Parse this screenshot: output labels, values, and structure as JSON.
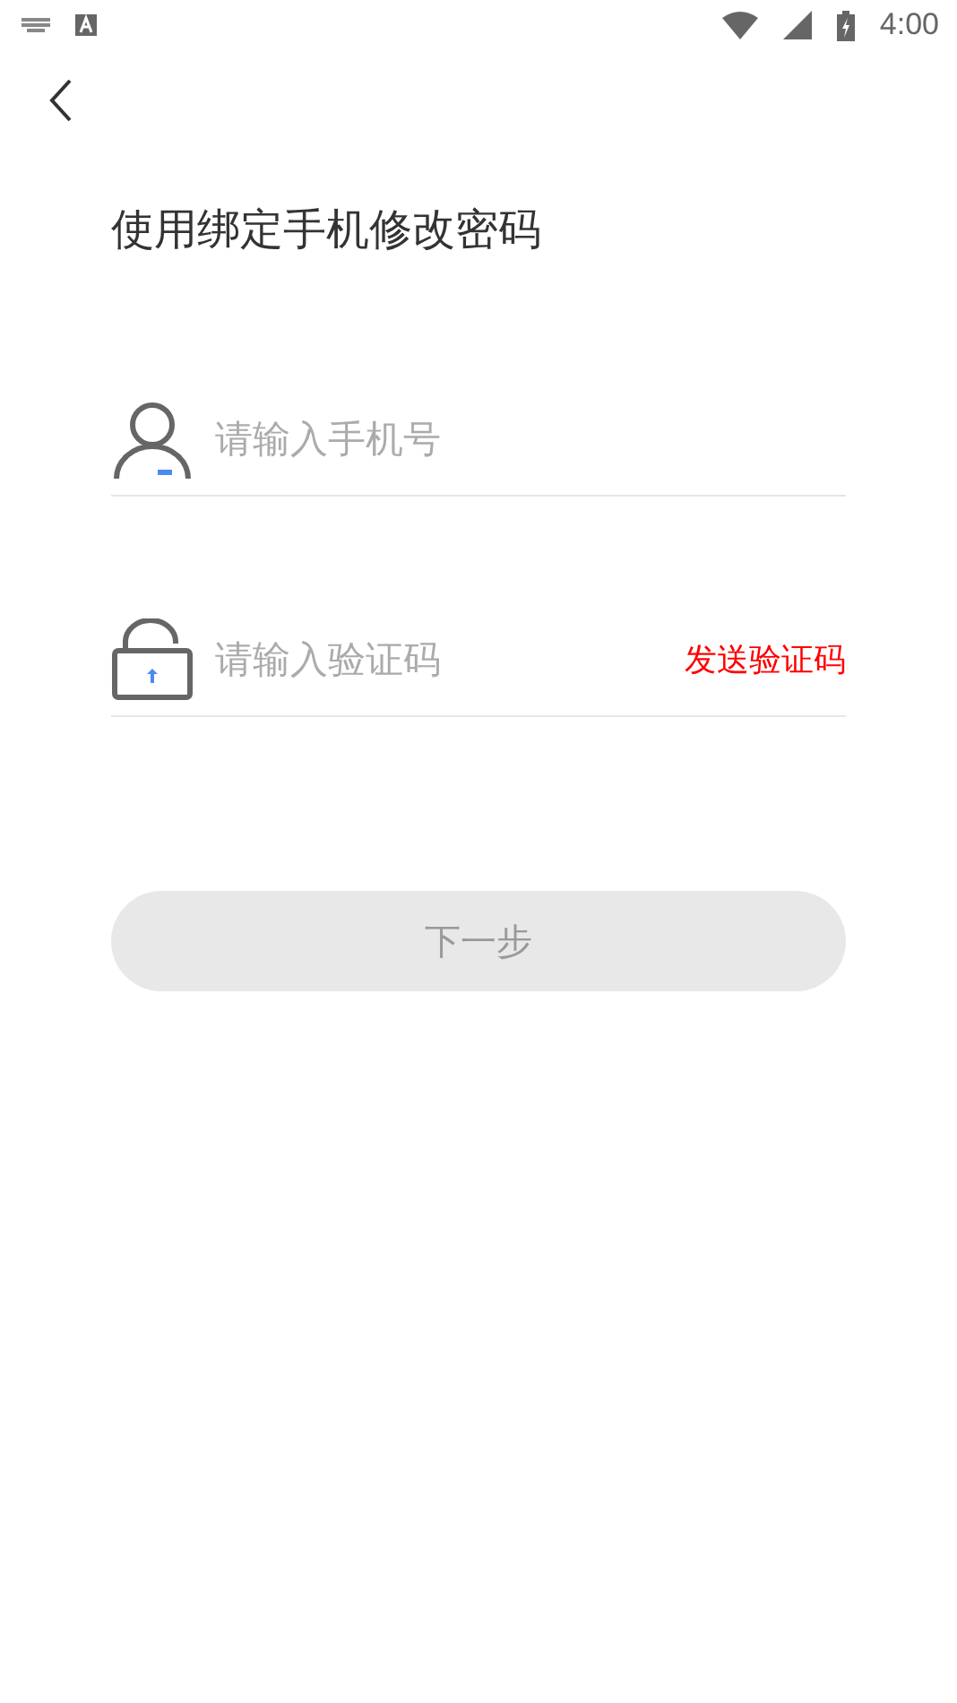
{
  "status_bar": {
    "time": "4:00"
  },
  "title": "使用绑定手机修改密码",
  "fields": [
    {
      "kind": "phone",
      "placeholder": "请输入手机号"
    },
    {
      "kind": "code",
      "placeholder": "请输入验证码",
      "action": "发送验证码"
    }
  ],
  "next_button": {
    "label": "下一步",
    "disabled": true
  }
}
